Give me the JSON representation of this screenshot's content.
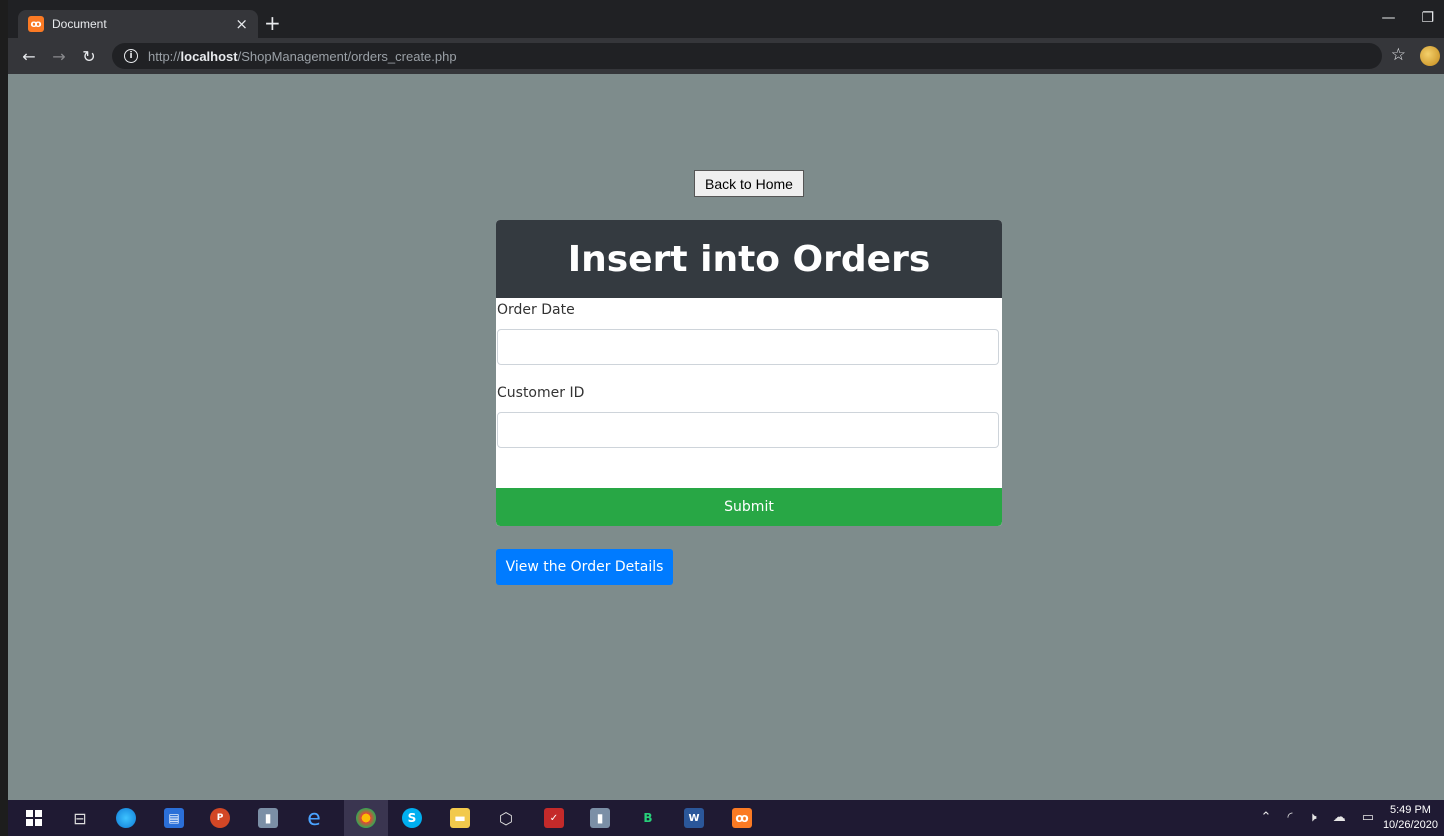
{
  "browser": {
    "tab_title": "Document",
    "tab_close": "×",
    "new_tab": "+",
    "url_prefix": "http://",
    "url_host": "localhost",
    "url_path": "/ShopManagement/orders_create.php"
  },
  "page": {
    "back_home_label": "Back to Home",
    "form_title": "Insert into Orders",
    "fields": [
      {
        "label": "Order Date",
        "value": ""
      },
      {
        "label": "Customer ID",
        "value": ""
      }
    ],
    "submit_label": "Submit",
    "view_details_label": "View the Order Details"
  },
  "taskbar": {
    "time": "5:49 PM",
    "date": "10/26/2020"
  },
  "colors": {
    "page_bg": "#7e8c8c",
    "card_header": "#343a40",
    "submit": "#28a745",
    "primary": "#007bff"
  }
}
